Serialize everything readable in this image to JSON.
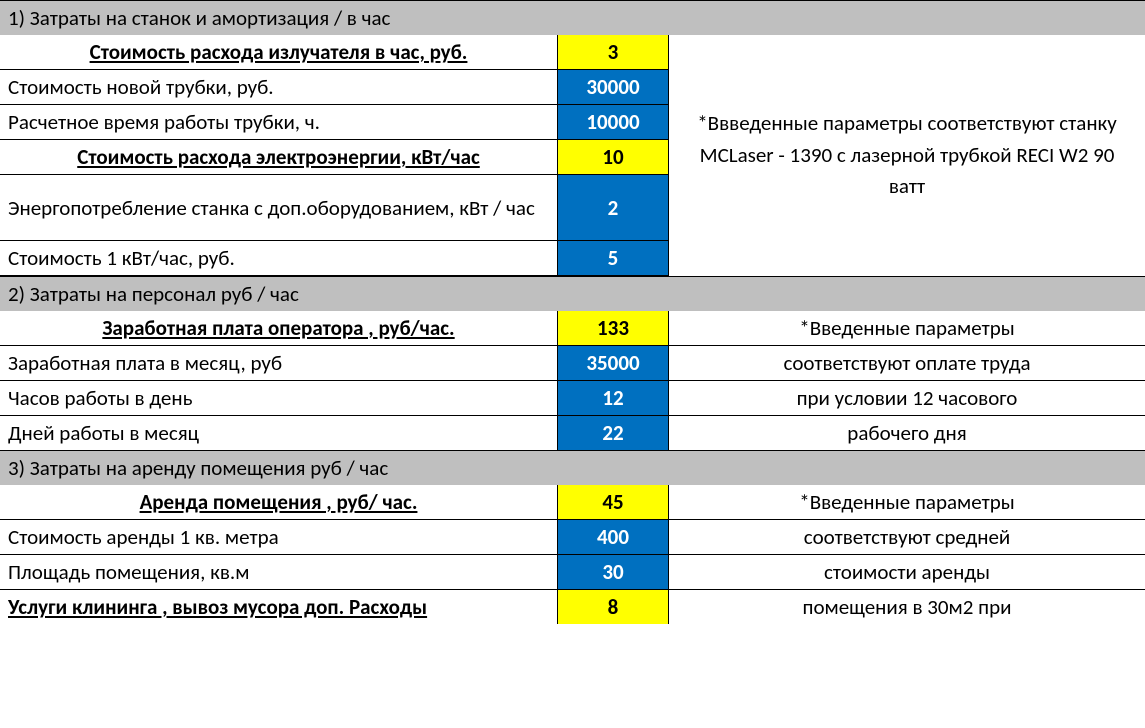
{
  "section1": {
    "header": "1)  Затраты на станок и амортизация / в час",
    "row1_label": "Стоимость расхода излучателя в час, руб.",
    "row1_value": "3",
    "row2_label": "Стоимость новой трубки, руб.",
    "row2_value": "30000",
    "row3_label": "Расчетное время  работы трубки, ч.",
    "row3_value": "10000",
    "row4_label": "Стоимость расхода электроэнергии, кВт/час",
    "row4_value": "10",
    "row5_label": "Энергопотребление станка с доп.оборудованием, кВт / час",
    "row5_value": "2",
    "row6_label": "Стоимость 1 кВт/час, руб.",
    "row6_value": "5",
    "note": "*Ввведенные параметры соответствуют станку MCLaser - 1390 с лазерной трубкой RECI W2 90 ватт"
  },
  "section2": {
    "header": "2) Затраты на персонал руб / час",
    "row1_label": "Заработная плата оператора , руб/час.",
    "row1_value": "133",
    "row2_label": "Заработная плата в месяц, руб",
    "row2_value": "35000",
    "row3_label": "Часов работы в день",
    "row3_value": "12",
    "row4_label": "Дней работы в месяц",
    "row4_value": "22",
    "note1": "*Введенные параметры",
    "note2": "соответствуют оплате труда",
    "note3": "при условии 12 часового",
    "note4": "рабочего дня"
  },
  "section3": {
    "header": "3) Затраты на аренду помещения руб / час",
    "row1_label": "Аренда помещения , руб/ час.",
    "row1_value": "45",
    "row2_label": "Стоимость аренды 1 кв. метра",
    "row2_value": "400",
    "row3_label": "Площадь помещения, кв.м",
    "row3_value": "30",
    "row4_label": "Услуги клининга , вывоз мусора доп. Расходы",
    "row4_value": "8",
    "note1": "*Введенные параметры",
    "note2": "соответствуют средней",
    "note3": "стоимости аренды",
    "note4": "помещения в 30м2 при"
  }
}
